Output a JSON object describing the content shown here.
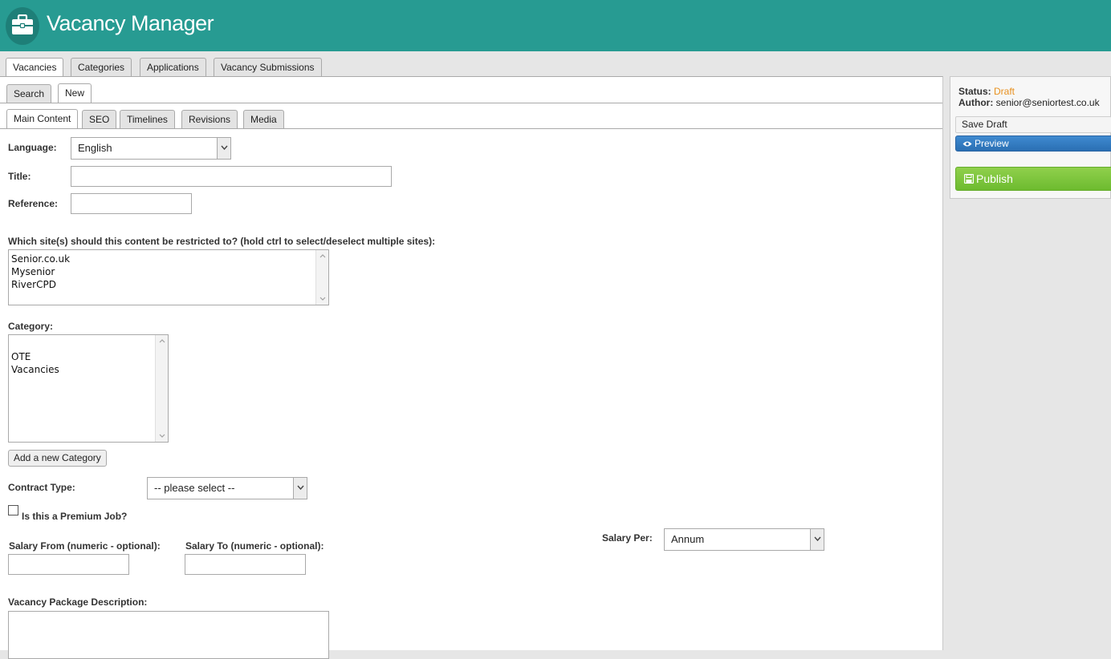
{
  "header": {
    "title": "Vacancy Manager",
    "logo_icon": "briefcase-icon"
  },
  "main_tabs": [
    {
      "label": "Vacancies",
      "active": true
    },
    {
      "label": "Categories",
      "active": false
    },
    {
      "label": "Applications",
      "active": false
    },
    {
      "label": "Vacancy Submissions",
      "active": false
    }
  ],
  "sub_tabs": [
    {
      "label": "Search",
      "active": false
    },
    {
      "label": "New",
      "active": true
    }
  ],
  "content_tabs": [
    {
      "label": "Main Content",
      "active": true
    },
    {
      "label": "SEO",
      "active": false
    },
    {
      "label": "Timelines",
      "active": false
    },
    {
      "label": "Revisions",
      "active": false
    },
    {
      "label": "Media",
      "active": false
    }
  ],
  "form": {
    "language": {
      "label": "Language:",
      "value": "English"
    },
    "title": {
      "label": "Title:",
      "value": ""
    },
    "reference": {
      "label": "Reference:",
      "value": ""
    },
    "sites": {
      "label": "Which site(s) should this content be restricted to? (hold ctrl to select/deselect multiple sites):",
      "options": [
        "Senior.co.uk",
        "Mysenior",
        "RiverCPD"
      ]
    },
    "category": {
      "label": "Category:",
      "options": [
        "",
        "OTE",
        "Vacancies"
      ]
    },
    "add_category_label": "Add a new Category",
    "contract_type": {
      "label": "Contract Type:",
      "value": "-- please select --"
    },
    "premium": {
      "label": "Is this a Premium Job?",
      "checked": false
    },
    "salary_from": {
      "label": "Salary From (numeric - optional):",
      "value": ""
    },
    "salary_to": {
      "label": "Salary To (numeric - optional):",
      "value": ""
    },
    "salary_per": {
      "label": "Salary Per:",
      "value": "Annum"
    },
    "package_description": {
      "label": "Vacancy Package Description:",
      "value": ""
    }
  },
  "sidebar": {
    "status_label": "Status:",
    "status_value": "Draft",
    "author_label": "Author:",
    "author_value": "senior@seniortest.co.uk",
    "save_draft_label": "Save Draft",
    "preview_label": "Preview",
    "publish_label": "Publish"
  },
  "colors": {
    "header": "#279b92",
    "draft_status": "#e8901e",
    "preview_button": "#2a6fb3",
    "publish_button": "#6dbb2f"
  }
}
